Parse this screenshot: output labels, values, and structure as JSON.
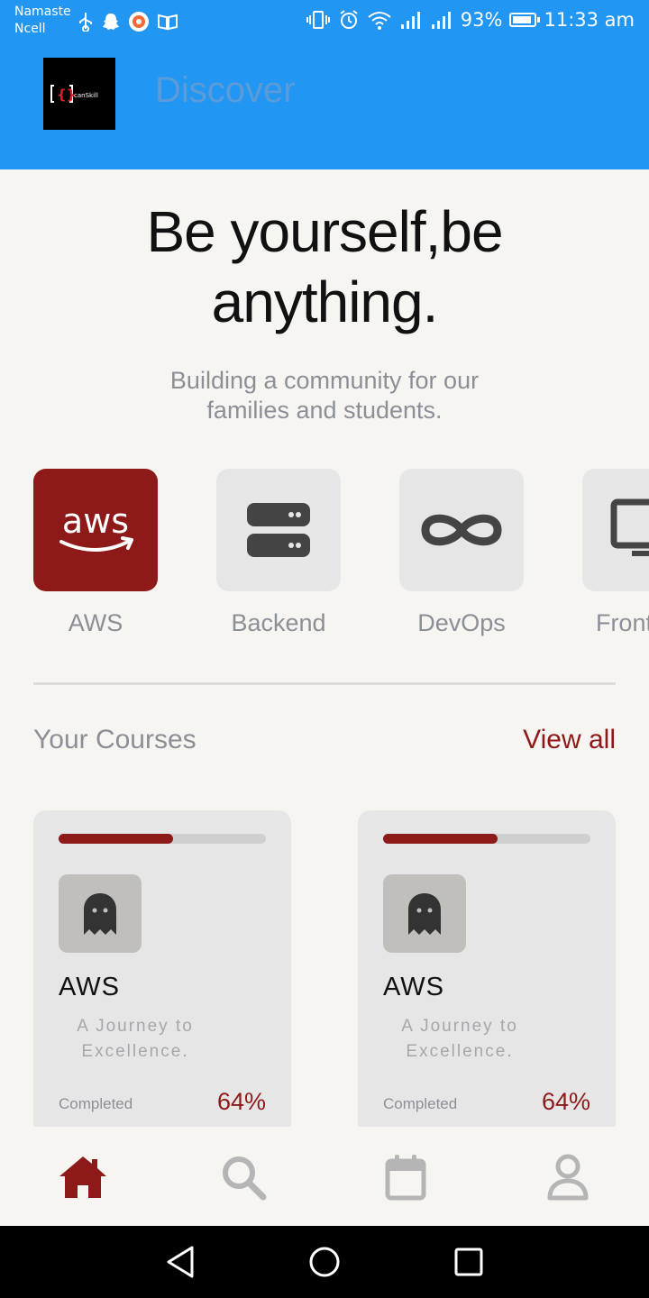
{
  "status_bar": {
    "carrier_line1": "Namaste",
    "carrier_line2": "Ncell",
    "battery": "93%",
    "time": "11:33 am"
  },
  "app_bar": {
    "logo_text": "canSkill",
    "title": "Discover"
  },
  "hero": {
    "title": "Be yourself,be anything.",
    "subtitle": "Building a community for our families and students."
  },
  "categories": [
    {
      "label": "AWS",
      "icon": "aws-icon",
      "active": true
    },
    {
      "label": "Backend",
      "icon": "server-icon",
      "active": false
    },
    {
      "label": "DevOps",
      "icon": "infinity-icon",
      "active": false
    },
    {
      "label": "Frontend",
      "icon": "monitor-icon",
      "active": false
    }
  ],
  "courses_section": {
    "title": "Your Courses",
    "view_all": "View all"
  },
  "courses": [
    {
      "title": "AWS",
      "description": "A Journey to Excellence.",
      "status_label": "Completed",
      "percent_label": "64%",
      "progress": 0.55,
      "icon": "ghost-icon"
    },
    {
      "title": "AWS",
      "description": "A Journey to Excellence.",
      "status_label": "Completed",
      "percent_label": "64%",
      "progress": 0.55,
      "icon": "ghost-icon"
    }
  ],
  "bottom_nav": [
    {
      "name": "home",
      "icon": "home-icon",
      "active": true
    },
    {
      "name": "search",
      "icon": "search-icon",
      "active": false
    },
    {
      "name": "calendar",
      "icon": "calendar-icon",
      "active": false
    },
    {
      "name": "profile",
      "icon": "user-icon",
      "active": false
    }
  ],
  "colors": {
    "app_bar": "#2196f3",
    "accent": "#8e1919",
    "background": "#f6f5f2",
    "muted_text": "#8c8f96"
  }
}
